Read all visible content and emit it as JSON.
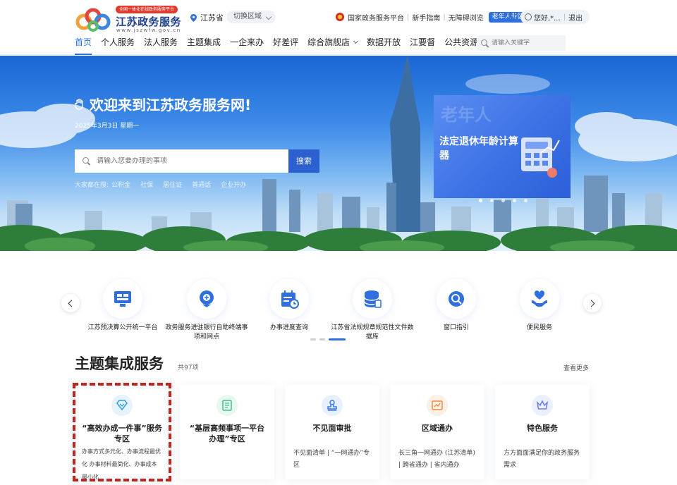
{
  "header": {
    "logo_tag": "全国一体化在线政务服务平台",
    "logo_name": "江苏政务服务",
    "logo_url": "www.jszwfw.gov.cn",
    "region": "江苏省",
    "switch_region": "切换区域",
    "top_links": [
      "国家政务服务平台",
      "新手指南",
      "无障碍浏览"
    ],
    "elder_zone": "老年人专区",
    "user_greeting": "您好,*...",
    "logout": "退出"
  },
  "nav": {
    "items": [
      "首页",
      "个人服务",
      "法人服务",
      "主题集成",
      "一企来办",
      "好差评",
      "综合旗舰店",
      "数据开放",
      "江要督",
      "公共资源交易"
    ],
    "active_index": 0,
    "search_placeholder": "请输入关键字"
  },
  "banner": {
    "welcome": "欢迎来到江苏政务服务网!",
    "date": "2025年3月3日 星期一",
    "search_placeholder": "请输入您要办理的事项",
    "search_button": "搜索",
    "hot_label": "大家都在搜:",
    "hot_words": [
      "公积金",
      "社保",
      "居住证",
      "普通话",
      "企业开办"
    ],
    "promo_bg_text": "老年人",
    "promo_title": "法定退休年龄计算器",
    "slide_count": 5,
    "active_slide": 0
  },
  "quick_links": [
    {
      "label": "江苏预决算公开统一平台",
      "icon": "monitor-icon"
    },
    {
      "label": "政务服务进驻银行自助终端事项和网点",
      "icon": "terminal-icon"
    },
    {
      "label": "办事进度查询",
      "icon": "calendar-clock-icon"
    },
    {
      "label": "江苏省法规规章规范性文件数据库",
      "icon": "database-icon"
    },
    {
      "label": "窗口指引",
      "icon": "guide-icon"
    },
    {
      "label": "便民服务",
      "icon": "heart-hand-icon"
    }
  ],
  "themed": {
    "title": "主题集成服务",
    "count": "共97项",
    "more": "查看更多",
    "cards": [
      {
        "title": "“高效办成一件事”服务专区",
        "desc": "办事方式多元化、办事流程最优化 办事材料最简化、办事成本最小化",
        "color": "#2f9be8",
        "icon": "diamond-heart-icon"
      },
      {
        "title": "“基层高频事项一平台办理”专区",
        "desc": "",
        "color": "#3cbf8a",
        "icon": "document-icon"
      },
      {
        "title": "不见面审批",
        "desc": "不见面清单 | “一网通办”专区",
        "color": "#3a78e6",
        "icon": "stamp-icon"
      },
      {
        "title": "区域通办",
        "desc": "长三角一网通办 (江苏清单) | 跨省通办 | 省内通办",
        "color": "#f08a3c",
        "icon": "map-icon"
      },
      {
        "title": "特色服务",
        "desc": "方方面面满足你的政务服务需求",
        "color": "#6a7fe8",
        "icon": "crown-icon"
      }
    ]
  }
}
